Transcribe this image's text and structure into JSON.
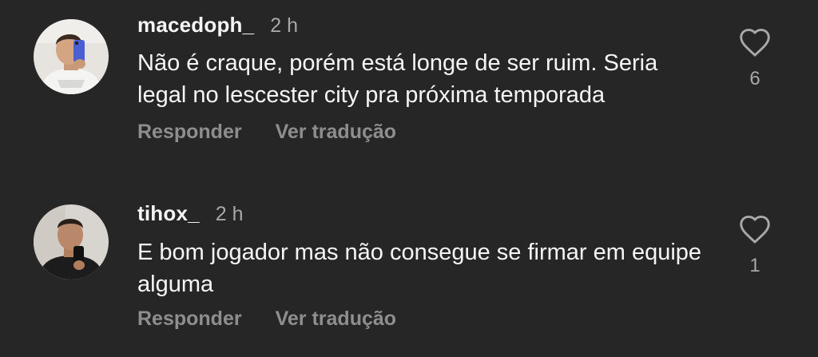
{
  "comments": [
    {
      "username": "macedoph_",
      "time": "2 h",
      "text": "Não é craque, porém está longe de ser ruim. Seria legal no lescester city pra próxima temporada",
      "reply_label": "Responder",
      "translate_label": "Ver tradução",
      "likes": "6",
      "like_icon": "heart-outline-icon"
    },
    {
      "username": "tihox_",
      "time": "2 h",
      "text": "E bom jogador mas não consegue se firmar em equipe alguma",
      "reply_label": "Responder",
      "translate_label": "Ver tradução",
      "likes": "1",
      "like_icon": "heart-outline-icon"
    }
  ],
  "colors": {
    "background": "#262626",
    "primary_text": "#f5f5f5",
    "secondary_text": "#a8a8a8",
    "action_text": "#8e8e8e"
  }
}
